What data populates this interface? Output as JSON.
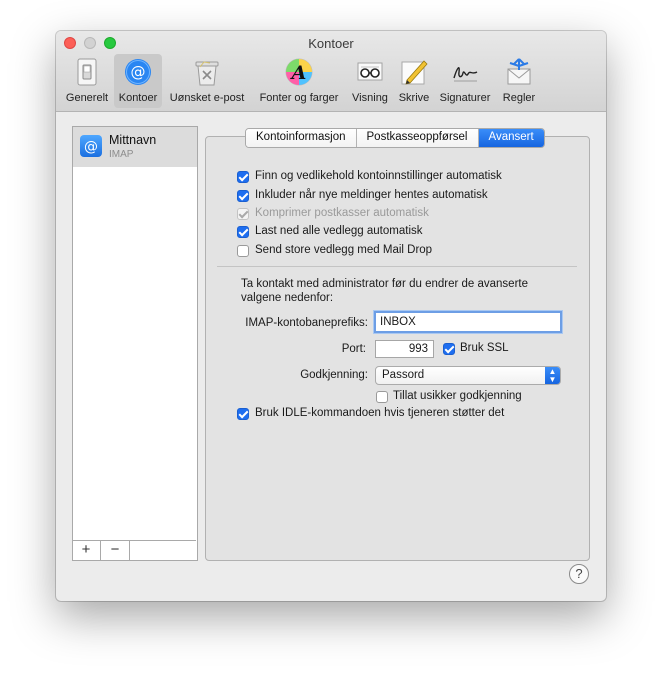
{
  "window": {
    "title": "Kontoer"
  },
  "toolbar": {
    "items": [
      {
        "label": "Generelt",
        "icon": "switch-icon"
      },
      {
        "label": "Kontoer",
        "icon": "at-icon",
        "selected": true
      },
      {
        "label": "Uønsket e-post",
        "icon": "trash-icon"
      },
      {
        "label": "Fonter og farger",
        "icon": "font-color-icon"
      },
      {
        "label": "Visning",
        "icon": "glasses-icon"
      },
      {
        "label": "Skrive",
        "icon": "pencil-icon"
      },
      {
        "label": "Signaturer",
        "icon": "signature-icon"
      },
      {
        "label": "Regler",
        "icon": "rules-icon"
      }
    ]
  },
  "sidebar": {
    "accounts": [
      {
        "name": "Mittnavn",
        "type": "IMAP"
      }
    ],
    "add_label": "+",
    "remove_label": "−"
  },
  "tabs": {
    "items": [
      "Kontoinformasjon",
      "Postkasseoppførsel",
      "Avansert"
    ],
    "selected": "Avansert"
  },
  "options": [
    {
      "label": "Finn og vedlikehold kontoinnstillinger automatisk",
      "checked": true,
      "enabled": true
    },
    {
      "label": "Inkluder når nye meldinger hentes automatisk",
      "checked": true,
      "enabled": true
    },
    {
      "label": "Komprimer postkasser automatisk",
      "checked": true,
      "enabled": false
    },
    {
      "label": "Last ned alle vedlegg automatisk",
      "checked": true,
      "enabled": true
    },
    {
      "label": "Send store vedlegg med Mail Drop",
      "checked": false,
      "enabled": true
    }
  ],
  "advanced": {
    "note": "Ta kontakt med administrator før du endrer de avanserte valgene nedenfor:",
    "imap_prefix_label": "IMAP-kontobaneprefiks:",
    "imap_prefix_value": "INBOX",
    "port_label": "Port:",
    "port_value": "993",
    "ssl_label": "Bruk SSL",
    "ssl_checked": true,
    "auth_label": "Godkjenning:",
    "auth_value": "Passord",
    "insecure_label": "Tillat usikker godkjenning",
    "insecure_checked": false,
    "idle_label": "Bruk IDLE-kommandoen hvis tjeneren støtter det",
    "idle_checked": true
  },
  "help": {
    "label": "?"
  },
  "colors": {
    "accent": "#1e6ef0",
    "selected_toolbar": "#c9c9c9",
    "window_bg": "#ececec"
  }
}
